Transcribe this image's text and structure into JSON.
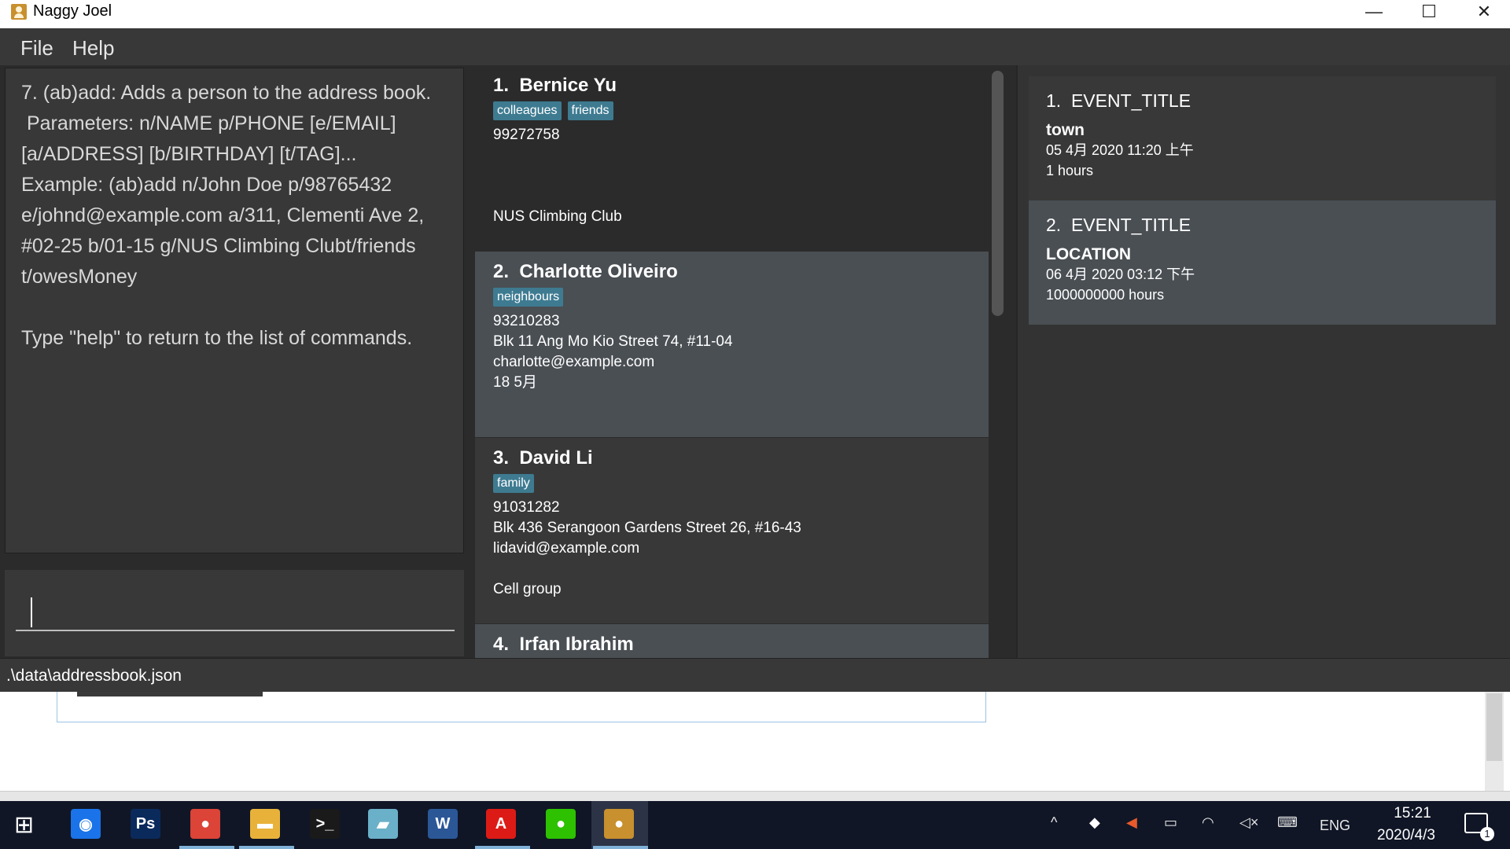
{
  "window": {
    "title": "Naggy Joel",
    "minimize": "—",
    "maximize": "☐",
    "close": "✕"
  },
  "menu": {
    "file": "File",
    "help": "Help"
  },
  "result_text": "7. (ab)add: Adds a person to the address book.\n Parameters: n/NAME p/PHONE [e/EMAIL]\n[a/ADDRESS] [b/BIRTHDAY] [t/TAG]...\nExample: (ab)add n/John Doe p/98765432\ne/johnd@example.com a/311, Clementi Ave 2,\n#02-25 b/01-15 g/NUS Climbing Clubt/friends\nt/owesMoney\n\nType \"help\" to return to the list of commands.",
  "command": {
    "value": ""
  },
  "persons": [
    {
      "header": "1.  Bernice Yu",
      "tags": [
        "colleagues",
        "friends"
      ],
      "phone": "99272758",
      "address": "",
      "email": "",
      "birthday": "",
      "group": "NUS Climbing Club"
    },
    {
      "header": "2.  Charlotte Oliveiro",
      "tags": [
        "neighbours"
      ],
      "phone": "93210283",
      "address": "Blk 11 Ang Mo Kio Street 74, #11-04",
      "email": "charlotte@example.com",
      "birthday": "18 5月",
      "group": ""
    },
    {
      "header": "3.  David Li",
      "tags": [
        "family"
      ],
      "phone": "91031282",
      "address": "Blk 436 Serangoon Gardens Street 26, #16-43",
      "email": "lidavid@example.com",
      "birthday": "",
      "group": "Cell group"
    },
    {
      "header": "4.  Irfan Ibrahim",
      "tags": [],
      "phone": "",
      "address": "",
      "email": "",
      "birthday": "",
      "group": ""
    }
  ],
  "events": [
    {
      "header": "1.  EVENT_TITLE",
      "location": "town",
      "datetime": "05 4月 2020 11:20 上午",
      "duration": "1 hours"
    },
    {
      "header": "2.  EVENT_TITLE",
      "location": "LOCATION",
      "datetime": "06 4月 2020 03:12 下午",
      "duration": "1000000000 hours"
    }
  ],
  "status": {
    "path": ".\\data\\addressbook.json"
  },
  "taskbar": {
    "start": "⊞",
    "apps": [
      {
        "name": "maps",
        "glyph": "◉",
        "color": "#1a73e8"
      },
      {
        "name": "photoshop",
        "glyph": "Ps",
        "color": "#0b2a5c"
      },
      {
        "name": "chrome",
        "glyph": "●",
        "color": "#db4437"
      },
      {
        "name": "file-explorer",
        "glyph": "▬",
        "color": "#e8b23a"
      },
      {
        "name": "terminal",
        "glyph": ">_",
        "color": "#1a1a1a"
      },
      {
        "name": "notes",
        "glyph": "▰",
        "color": "#6ab0c8"
      },
      {
        "name": "word",
        "glyph": "W",
        "color": "#2b5797"
      },
      {
        "name": "angular",
        "glyph": "A",
        "color": "#dd1b16"
      },
      {
        "name": "wechat",
        "glyph": "●",
        "color": "#2dc100"
      },
      {
        "name": "addressbook",
        "glyph": "●",
        "color": "#c8902e"
      }
    ],
    "tray": {
      "chevron": "^",
      "language": "ENG"
    },
    "clock": {
      "time": "15:21",
      "date": "2020/4/3"
    },
    "notifications": "1"
  }
}
